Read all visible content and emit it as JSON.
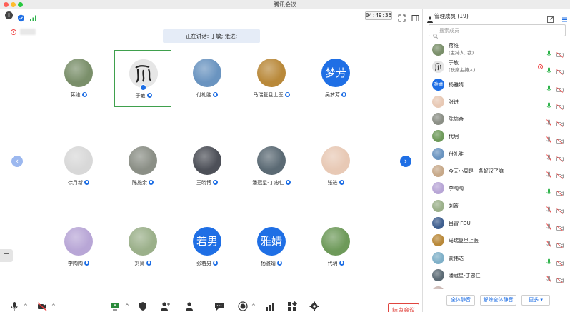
{
  "window": {
    "title": "腾讯会议"
  },
  "topbar": {
    "timer": "04:49:36"
  },
  "speaking": {
    "label": "正在讲话: 于敏; 张进;"
  },
  "nav": {
    "prev": "‹",
    "next": "›"
  },
  "grid": [
    {
      "name": "蒋维",
      "avatar": "photo",
      "color": "#7a8f6a"
    },
    {
      "name": "于敏",
      "avatar": "ink",
      "color": "#dcdcdc",
      "active": true
    },
    {
      "name": "付礼胜",
      "avatar": "photo",
      "color": "#6a94c0"
    },
    {
      "name": "马瑞复旦上医",
      "avatar": "photo",
      "color": "#b9893a"
    },
    {
      "name": "吴梦芳",
      "avatar": "text",
      "avatar_text": "梦芳"
    },
    {
      "name": "徐月新",
      "avatar": "photo",
      "color": "#d8d8d8"
    },
    {
      "name": "陈施余",
      "avatar": "photo",
      "color": "#8b8f86"
    },
    {
      "name": "王晓博",
      "avatar": "photo",
      "color": "#4d5058"
    },
    {
      "name": "潘冠星-丁忠仁",
      "avatar": "photo",
      "color": "#5b6a74"
    },
    {
      "name": "张进",
      "avatar": "photo",
      "color": "#e8c9b5"
    },
    {
      "name": "李陶陶",
      "avatar": "photo",
      "color": "#b8a6d6"
    },
    {
      "name": "刘簧",
      "avatar": "photo",
      "color": "#9bb08a"
    },
    {
      "name": "张若男",
      "avatar": "text",
      "avatar_text": "若男"
    },
    {
      "name": "杨雅婧",
      "avatar": "text",
      "avatar_text": "雅婧"
    },
    {
      "name": "代玥",
      "avatar": "photo",
      "color": "#6e9a5a"
    }
  ],
  "toolbar": {
    "tools": [
      {
        "id": "mute",
        "label": "静音",
        "icon": "mic-icon"
      },
      {
        "id": "video",
        "label": "开启视频",
        "icon": "video-off-icon"
      },
      {
        "id": "share",
        "label": "共享屏幕",
        "icon": "screen-share-icon"
      },
      {
        "id": "security",
        "label": "安全",
        "icon": "shield-icon"
      },
      {
        "id": "invite",
        "label": "邀请",
        "icon": "invite-icon"
      },
      {
        "id": "members",
        "label": "管理成员(19)",
        "icon": "members-icon"
      },
      {
        "id": "chat",
        "label": "聊天",
        "icon": "chat-icon"
      },
      {
        "id": "record",
        "label": "录制",
        "icon": "record-icon"
      },
      {
        "id": "breakout",
        "label": "分组讨论",
        "icon": "breakout-icon"
      },
      {
        "id": "apps",
        "label": "应用",
        "icon": "apps-icon"
      },
      {
        "id": "settings",
        "label": "设置",
        "icon": "gear-icon"
      }
    ],
    "end_label": "结束会议"
  },
  "panel": {
    "title": "管理成员 (19)",
    "search_placeholder": "搜索成员",
    "members": [
      {
        "name": "蒋维",
        "sub": "(主持人, 我)",
        "avatar": "photo",
        "color": "#7a8f6a",
        "mic": "on"
      },
      {
        "name": "于敏",
        "sub": "(联席主持人)",
        "avatar": "ink",
        "color": "#dcdcdc",
        "mic": "on",
        "rec": true
      },
      {
        "name": "杨雅婧",
        "avatar": "text",
        "avatar_text": "雅婧",
        "mic": "on"
      },
      {
        "name": "张进",
        "avatar": "photo",
        "color": "#e8c9b5",
        "mic": "on"
      },
      {
        "name": "陈施余",
        "avatar": "photo",
        "color": "#8b8f86",
        "mic": "muted"
      },
      {
        "name": "代玥",
        "avatar": "photo",
        "color": "#6e9a5a",
        "mic": "muted"
      },
      {
        "name": "付礼胜",
        "avatar": "photo",
        "color": "#6a94c0",
        "mic": "muted"
      },
      {
        "name": "今天小周是一条好汉了嘛",
        "avatar": "photo",
        "color": "#c7a98a",
        "mic": "muted"
      },
      {
        "name": "李陶陶",
        "avatar": "photo",
        "color": "#b8a6d6",
        "mic": "on"
      },
      {
        "name": "刘簧",
        "avatar": "photo",
        "color": "#9bb08a",
        "mic": "muted"
      },
      {
        "name": "吕雷 FDU",
        "avatar": "photo",
        "color": "#3f5f8f",
        "mic": "muted"
      },
      {
        "name": "马瑞复旦上医",
        "avatar": "photo",
        "color": "#b9893a",
        "mic": "muted"
      },
      {
        "name": "蒙伟达",
        "avatar": "photo",
        "color": "#7fb0c8",
        "mic": "on"
      },
      {
        "name": "潘冠星-丁忠仁",
        "avatar": "photo",
        "color": "#5b6a74",
        "mic": "muted"
      },
      {
        "name": "",
        "avatar": "photo",
        "color": "#c9b5b0",
        "mic": "muted"
      }
    ],
    "footer": {
      "mute_all": "全体静音",
      "unmute_all": "解除全体静音",
      "more": "更多 ▾"
    }
  }
}
